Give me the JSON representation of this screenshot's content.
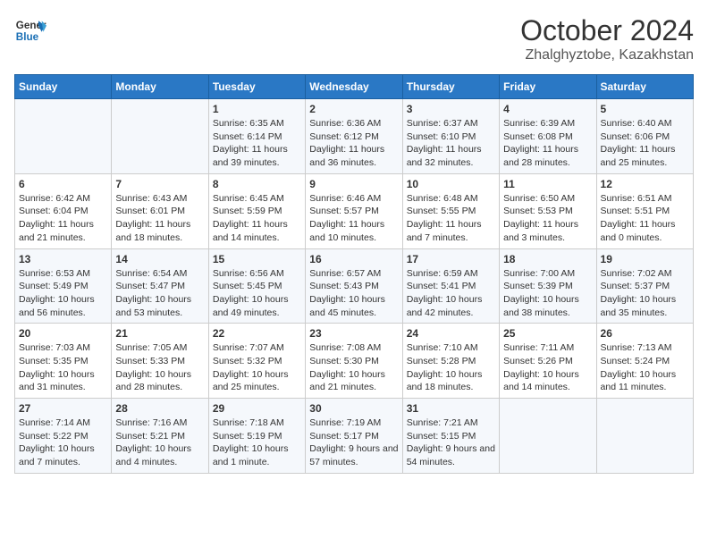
{
  "header": {
    "logo_line1": "General",
    "logo_line2": "Blue",
    "month": "October 2024",
    "location": "Zhalghyztobe, Kazakhstan"
  },
  "weekdays": [
    "Sunday",
    "Monday",
    "Tuesday",
    "Wednesday",
    "Thursday",
    "Friday",
    "Saturday"
  ],
  "weeks": [
    [
      {
        "day": "",
        "info": ""
      },
      {
        "day": "",
        "info": ""
      },
      {
        "day": "1",
        "info": "Sunrise: 6:35 AM\nSunset: 6:14 PM\nDaylight: 11 hours and 39 minutes."
      },
      {
        "day": "2",
        "info": "Sunrise: 6:36 AM\nSunset: 6:12 PM\nDaylight: 11 hours and 36 minutes."
      },
      {
        "day": "3",
        "info": "Sunrise: 6:37 AM\nSunset: 6:10 PM\nDaylight: 11 hours and 32 minutes."
      },
      {
        "day": "4",
        "info": "Sunrise: 6:39 AM\nSunset: 6:08 PM\nDaylight: 11 hours and 28 minutes."
      },
      {
        "day": "5",
        "info": "Sunrise: 6:40 AM\nSunset: 6:06 PM\nDaylight: 11 hours and 25 minutes."
      }
    ],
    [
      {
        "day": "6",
        "info": "Sunrise: 6:42 AM\nSunset: 6:04 PM\nDaylight: 11 hours and 21 minutes."
      },
      {
        "day": "7",
        "info": "Sunrise: 6:43 AM\nSunset: 6:01 PM\nDaylight: 11 hours and 18 minutes."
      },
      {
        "day": "8",
        "info": "Sunrise: 6:45 AM\nSunset: 5:59 PM\nDaylight: 11 hours and 14 minutes."
      },
      {
        "day": "9",
        "info": "Sunrise: 6:46 AM\nSunset: 5:57 PM\nDaylight: 11 hours and 10 minutes."
      },
      {
        "day": "10",
        "info": "Sunrise: 6:48 AM\nSunset: 5:55 PM\nDaylight: 11 hours and 7 minutes."
      },
      {
        "day": "11",
        "info": "Sunrise: 6:50 AM\nSunset: 5:53 PM\nDaylight: 11 hours and 3 minutes."
      },
      {
        "day": "12",
        "info": "Sunrise: 6:51 AM\nSunset: 5:51 PM\nDaylight: 11 hours and 0 minutes."
      }
    ],
    [
      {
        "day": "13",
        "info": "Sunrise: 6:53 AM\nSunset: 5:49 PM\nDaylight: 10 hours and 56 minutes."
      },
      {
        "day": "14",
        "info": "Sunrise: 6:54 AM\nSunset: 5:47 PM\nDaylight: 10 hours and 53 minutes."
      },
      {
        "day": "15",
        "info": "Sunrise: 6:56 AM\nSunset: 5:45 PM\nDaylight: 10 hours and 49 minutes."
      },
      {
        "day": "16",
        "info": "Sunrise: 6:57 AM\nSunset: 5:43 PM\nDaylight: 10 hours and 45 minutes."
      },
      {
        "day": "17",
        "info": "Sunrise: 6:59 AM\nSunset: 5:41 PM\nDaylight: 10 hours and 42 minutes."
      },
      {
        "day": "18",
        "info": "Sunrise: 7:00 AM\nSunset: 5:39 PM\nDaylight: 10 hours and 38 minutes."
      },
      {
        "day": "19",
        "info": "Sunrise: 7:02 AM\nSunset: 5:37 PM\nDaylight: 10 hours and 35 minutes."
      }
    ],
    [
      {
        "day": "20",
        "info": "Sunrise: 7:03 AM\nSunset: 5:35 PM\nDaylight: 10 hours and 31 minutes."
      },
      {
        "day": "21",
        "info": "Sunrise: 7:05 AM\nSunset: 5:33 PM\nDaylight: 10 hours and 28 minutes."
      },
      {
        "day": "22",
        "info": "Sunrise: 7:07 AM\nSunset: 5:32 PM\nDaylight: 10 hours and 25 minutes."
      },
      {
        "day": "23",
        "info": "Sunrise: 7:08 AM\nSunset: 5:30 PM\nDaylight: 10 hours and 21 minutes."
      },
      {
        "day": "24",
        "info": "Sunrise: 7:10 AM\nSunset: 5:28 PM\nDaylight: 10 hours and 18 minutes."
      },
      {
        "day": "25",
        "info": "Sunrise: 7:11 AM\nSunset: 5:26 PM\nDaylight: 10 hours and 14 minutes."
      },
      {
        "day": "26",
        "info": "Sunrise: 7:13 AM\nSunset: 5:24 PM\nDaylight: 10 hours and 11 minutes."
      }
    ],
    [
      {
        "day": "27",
        "info": "Sunrise: 7:14 AM\nSunset: 5:22 PM\nDaylight: 10 hours and 7 minutes."
      },
      {
        "day": "28",
        "info": "Sunrise: 7:16 AM\nSunset: 5:21 PM\nDaylight: 10 hours and 4 minutes."
      },
      {
        "day": "29",
        "info": "Sunrise: 7:18 AM\nSunset: 5:19 PM\nDaylight: 10 hours and 1 minute."
      },
      {
        "day": "30",
        "info": "Sunrise: 7:19 AM\nSunset: 5:17 PM\nDaylight: 9 hours and 57 minutes."
      },
      {
        "day": "31",
        "info": "Sunrise: 7:21 AM\nSunset: 5:15 PM\nDaylight: 9 hours and 54 minutes."
      },
      {
        "day": "",
        "info": ""
      },
      {
        "day": "",
        "info": ""
      }
    ]
  ]
}
